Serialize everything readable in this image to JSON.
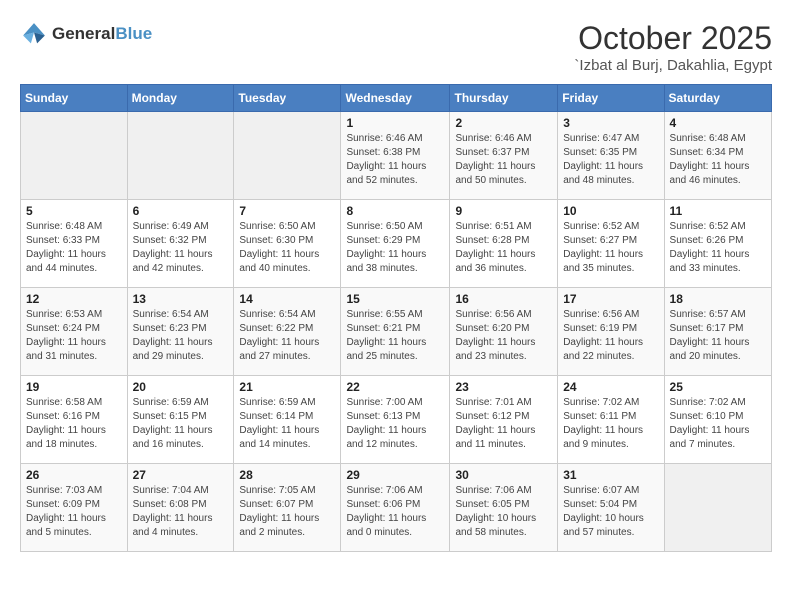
{
  "header": {
    "logo_general": "General",
    "logo_blue": "Blue",
    "month": "October 2025",
    "location": "`Izbat al Burj, Dakahlia, Egypt"
  },
  "weekdays": [
    "Sunday",
    "Monday",
    "Tuesday",
    "Wednesday",
    "Thursday",
    "Friday",
    "Saturday"
  ],
  "weeks": [
    [
      {
        "day": "",
        "info": ""
      },
      {
        "day": "",
        "info": ""
      },
      {
        "day": "",
        "info": ""
      },
      {
        "day": "1",
        "info": "Sunrise: 6:46 AM\nSunset: 6:38 PM\nDaylight: 11 hours and 52 minutes."
      },
      {
        "day": "2",
        "info": "Sunrise: 6:46 AM\nSunset: 6:37 PM\nDaylight: 11 hours and 50 minutes."
      },
      {
        "day": "3",
        "info": "Sunrise: 6:47 AM\nSunset: 6:35 PM\nDaylight: 11 hours and 48 minutes."
      },
      {
        "day": "4",
        "info": "Sunrise: 6:48 AM\nSunset: 6:34 PM\nDaylight: 11 hours and 46 minutes."
      }
    ],
    [
      {
        "day": "5",
        "info": "Sunrise: 6:48 AM\nSunset: 6:33 PM\nDaylight: 11 hours and 44 minutes."
      },
      {
        "day": "6",
        "info": "Sunrise: 6:49 AM\nSunset: 6:32 PM\nDaylight: 11 hours and 42 minutes."
      },
      {
        "day": "7",
        "info": "Sunrise: 6:50 AM\nSunset: 6:30 PM\nDaylight: 11 hours and 40 minutes."
      },
      {
        "day": "8",
        "info": "Sunrise: 6:50 AM\nSunset: 6:29 PM\nDaylight: 11 hours and 38 minutes."
      },
      {
        "day": "9",
        "info": "Sunrise: 6:51 AM\nSunset: 6:28 PM\nDaylight: 11 hours and 36 minutes."
      },
      {
        "day": "10",
        "info": "Sunrise: 6:52 AM\nSunset: 6:27 PM\nDaylight: 11 hours and 35 minutes."
      },
      {
        "day": "11",
        "info": "Sunrise: 6:52 AM\nSunset: 6:26 PM\nDaylight: 11 hours and 33 minutes."
      }
    ],
    [
      {
        "day": "12",
        "info": "Sunrise: 6:53 AM\nSunset: 6:24 PM\nDaylight: 11 hours and 31 minutes."
      },
      {
        "day": "13",
        "info": "Sunrise: 6:54 AM\nSunset: 6:23 PM\nDaylight: 11 hours and 29 minutes."
      },
      {
        "day": "14",
        "info": "Sunrise: 6:54 AM\nSunset: 6:22 PM\nDaylight: 11 hours and 27 minutes."
      },
      {
        "day": "15",
        "info": "Sunrise: 6:55 AM\nSunset: 6:21 PM\nDaylight: 11 hours and 25 minutes."
      },
      {
        "day": "16",
        "info": "Sunrise: 6:56 AM\nSunset: 6:20 PM\nDaylight: 11 hours and 23 minutes."
      },
      {
        "day": "17",
        "info": "Sunrise: 6:56 AM\nSunset: 6:19 PM\nDaylight: 11 hours and 22 minutes."
      },
      {
        "day": "18",
        "info": "Sunrise: 6:57 AM\nSunset: 6:17 PM\nDaylight: 11 hours and 20 minutes."
      }
    ],
    [
      {
        "day": "19",
        "info": "Sunrise: 6:58 AM\nSunset: 6:16 PM\nDaylight: 11 hours and 18 minutes."
      },
      {
        "day": "20",
        "info": "Sunrise: 6:59 AM\nSunset: 6:15 PM\nDaylight: 11 hours and 16 minutes."
      },
      {
        "day": "21",
        "info": "Sunrise: 6:59 AM\nSunset: 6:14 PM\nDaylight: 11 hours and 14 minutes."
      },
      {
        "day": "22",
        "info": "Sunrise: 7:00 AM\nSunset: 6:13 PM\nDaylight: 11 hours and 12 minutes."
      },
      {
        "day": "23",
        "info": "Sunrise: 7:01 AM\nSunset: 6:12 PM\nDaylight: 11 hours and 11 minutes."
      },
      {
        "day": "24",
        "info": "Sunrise: 7:02 AM\nSunset: 6:11 PM\nDaylight: 11 hours and 9 minutes."
      },
      {
        "day": "25",
        "info": "Sunrise: 7:02 AM\nSunset: 6:10 PM\nDaylight: 11 hours and 7 minutes."
      }
    ],
    [
      {
        "day": "26",
        "info": "Sunrise: 7:03 AM\nSunset: 6:09 PM\nDaylight: 11 hours and 5 minutes."
      },
      {
        "day": "27",
        "info": "Sunrise: 7:04 AM\nSunset: 6:08 PM\nDaylight: 11 hours and 4 minutes."
      },
      {
        "day": "28",
        "info": "Sunrise: 7:05 AM\nSunset: 6:07 PM\nDaylight: 11 hours and 2 minutes."
      },
      {
        "day": "29",
        "info": "Sunrise: 7:06 AM\nSunset: 6:06 PM\nDaylight: 11 hours and 0 minutes."
      },
      {
        "day": "30",
        "info": "Sunrise: 7:06 AM\nSunset: 6:05 PM\nDaylight: 10 hours and 58 minutes."
      },
      {
        "day": "31",
        "info": "Sunrise: 6:07 AM\nSunset: 5:04 PM\nDaylight: 10 hours and 57 minutes."
      },
      {
        "day": "",
        "info": ""
      }
    ]
  ]
}
